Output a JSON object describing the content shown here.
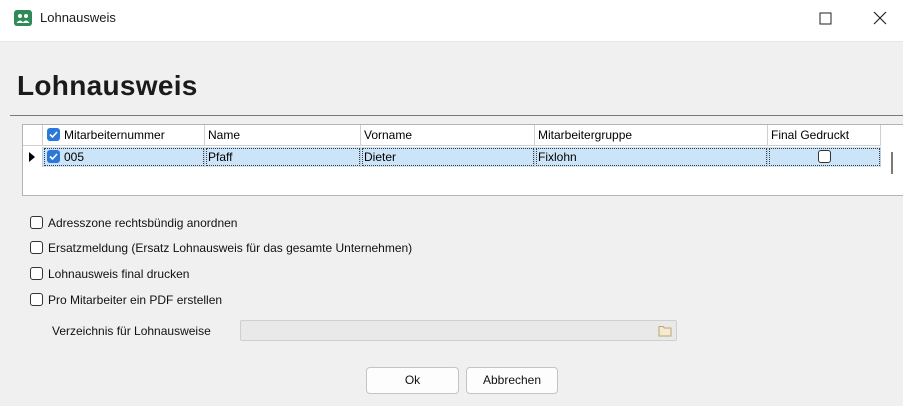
{
  "window": {
    "title": "Lohnausweis",
    "icon": "people-icon"
  },
  "page": {
    "heading": "Lohnausweis"
  },
  "grid": {
    "columns": [
      "Mitarbeiternummer",
      "Name",
      "Vorname",
      "Mitarbeitergruppe",
      "Final Gedruckt"
    ],
    "header_checked": true,
    "rows": [
      {
        "selected": true,
        "checked": true,
        "mitarbeiternummer": "005",
        "name": "Pfaff",
        "vorname": "Dieter",
        "mitarbeitergruppe": "Fixlohn",
        "final_gedruckt": false
      }
    ]
  },
  "options": [
    {
      "label": "Adresszone rechtsbündig anordnen",
      "checked": false
    },
    {
      "label": "Ersatzmeldung (Ersatz Lohnausweis für das gesamte Unternehmen)",
      "checked": false
    },
    {
      "label": "Lohnausweis final drucken",
      "checked": false
    },
    {
      "label": "Pro Mitarbeiter ein PDF erstellen",
      "checked": false
    }
  ],
  "directory": {
    "label": "Verzeichnis für Lohnausweise",
    "value": "",
    "enabled": false
  },
  "buttons": {
    "ok": "Ok",
    "cancel": "Abbrechen"
  },
  "colors": {
    "row_selection": "#cce4f7",
    "checkbox_accent": "#2a79d8",
    "app_icon": "#2e8b57"
  }
}
